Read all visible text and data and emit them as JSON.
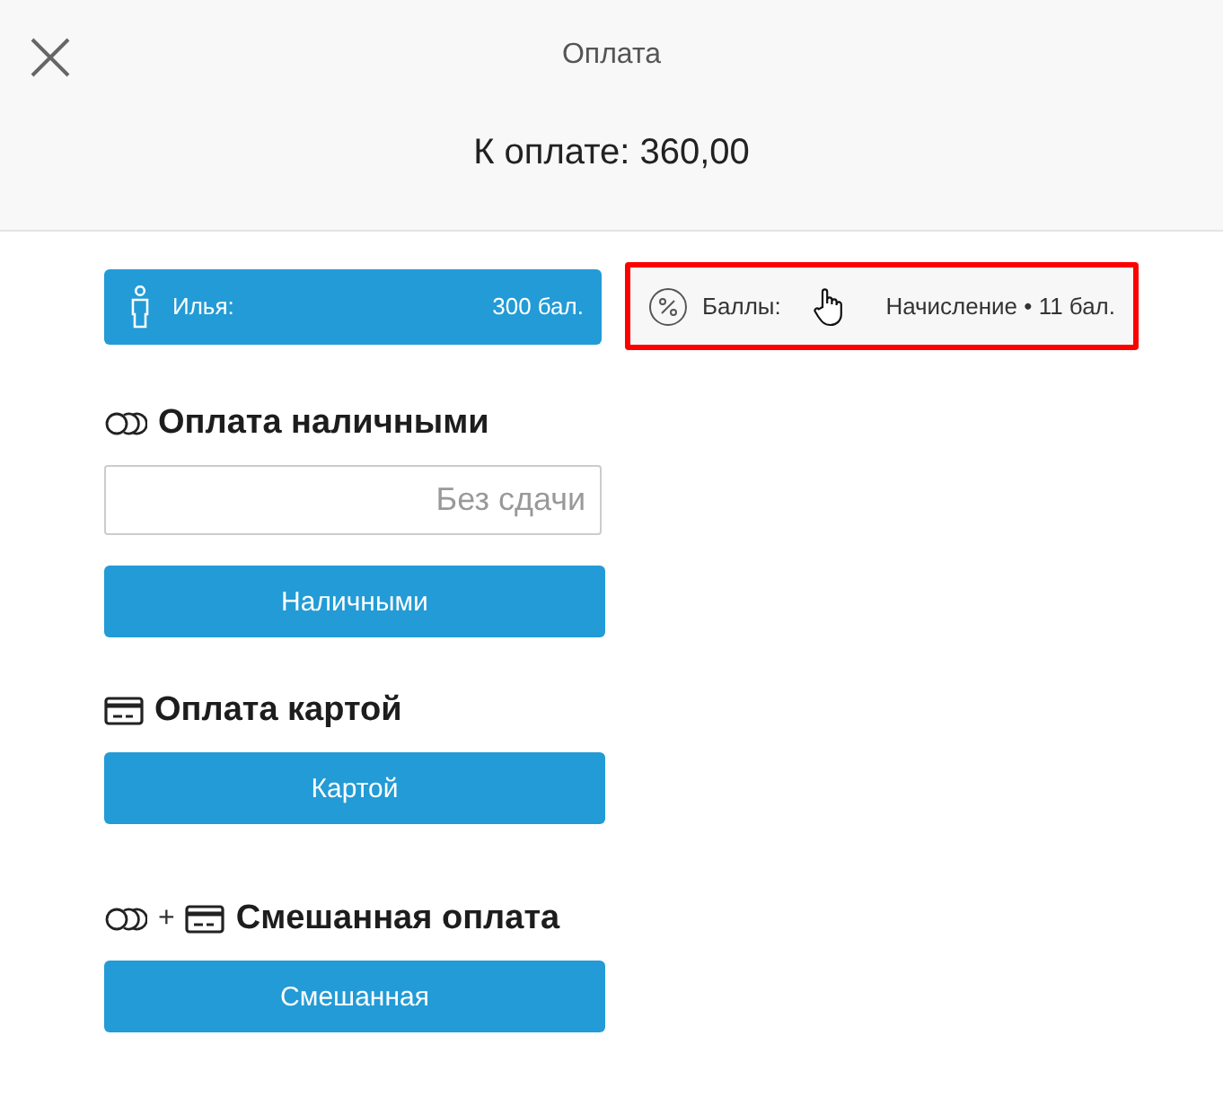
{
  "header": {
    "title": "Оплата",
    "amount": "К оплате: 360,00"
  },
  "customer": {
    "name": "Илья:",
    "points": "300 бал."
  },
  "bonus": {
    "label": "Баллы:",
    "value": "Начисление • 11 бал.",
    "highlighted": true
  },
  "sections": [
    {
      "kind": "cash",
      "title": "Оплата наличными",
      "placeholder": "Без сдачи",
      "button": "Наличными"
    },
    {
      "kind": "card",
      "title": "Оплата картой",
      "button": "Картой"
    },
    {
      "kind": "mixed",
      "title": "Смешанная оплата",
      "joiner": "+",
      "button": "Смешанная"
    }
  ]
}
